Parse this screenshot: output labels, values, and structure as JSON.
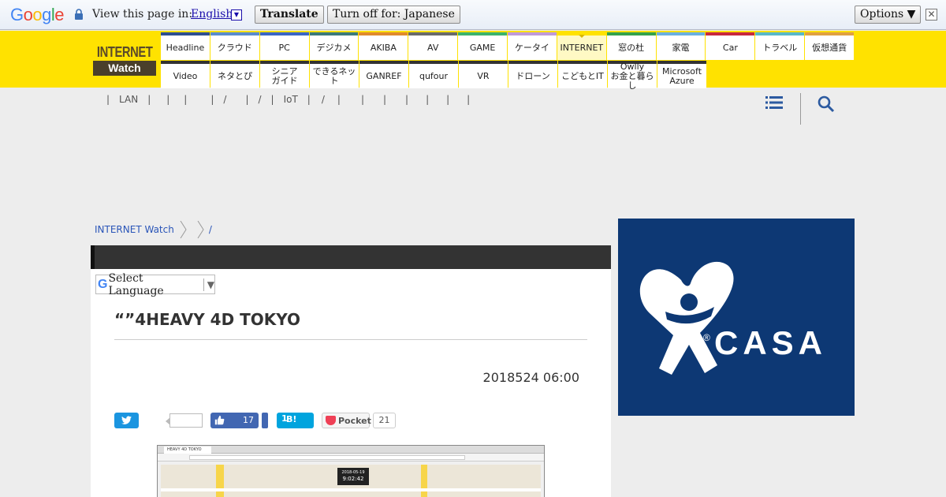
{
  "translate_bar": {
    "logo": [
      "G",
      "o",
      "o",
      "g",
      "l",
      "e"
    ],
    "logo_colors": [
      "#4285f4",
      "#ea4335",
      "#fbbc05",
      "#4285f4",
      "#34a853",
      "#ea4335"
    ],
    "view_text": "View this page in:",
    "language": "English",
    "translate_label": "Translate",
    "turn_off_label": "Turn off for: Japanese",
    "options_label": "Options ▼",
    "close_glyph": "✕"
  },
  "logo": {
    "top": "INTERNET",
    "bottom": "Watch"
  },
  "nav": {
    "row1": [
      {
        "label": "Headline",
        "color": "#2e4f8f"
      },
      {
        "label": "クラウド",
        "color": "#5a8ccc"
      },
      {
        "label": "PC",
        "color": "#3a66c4"
      },
      {
        "label": "デジカメ",
        "color": "#3c7a7a"
      },
      {
        "label": "AKIBA",
        "color": "#e08a2c"
      },
      {
        "label": "AV",
        "color": "#6a6a6a"
      },
      {
        "label": "GAME",
        "color": "#3bb36b"
      },
      {
        "label": "ケータイ",
        "color": "#c09ad8"
      },
      {
        "label": "INTERNET",
        "color": "#ffe200",
        "active": true
      },
      {
        "label": "窓の杜",
        "color": "#35a24a"
      },
      {
        "label": "家電",
        "color": "#6ab0e0"
      },
      {
        "label": "Car",
        "color": "#c8283c"
      },
      {
        "label": "トラベル",
        "color": "#58b8c8"
      },
      {
        "label": "仮想通貨",
        "color": "#e0a040"
      }
    ],
    "row2": [
      {
        "label": "Video"
      },
      {
        "label": "ネタとぴ"
      },
      {
        "label": "シニア\nガイド"
      },
      {
        "label": "できるネット"
      },
      {
        "label": "GANREF"
      },
      {
        "label": "qufour"
      },
      {
        "label": "VR"
      },
      {
        "label": "ドローン"
      },
      {
        "label": "こどもとIT"
      },
      {
        "label": "Owlly\nお金と暮らし"
      },
      {
        "label": "Microsoft\nAzure"
      }
    ]
  },
  "subnav": [
    "|",
    "LAN",
    "|",
    "|",
    "|",
    "|",
    "/",
    "|",
    "/",
    "|",
    "IoT",
    "|",
    "/",
    "|",
    "|",
    "|",
    "|",
    "|",
    "|",
    "|"
  ],
  "breadcrumb": {
    "home": "INTERNET Watch",
    "last": "/"
  },
  "select_language": "Select Language",
  "article": {
    "title": "“”4HEAVY 4D TOKYO",
    "date": "2018524 06:00"
  },
  "share": {
    "facebook_count": "17",
    "hatena_label": "B!",
    "hatena_count": "1",
    "pocket_label": "Pocket",
    "pocket_count": "21"
  },
  "screenshot": {
    "tab_title": "HEAVY 4D TOKYO",
    "clock_date": "2018-05-19",
    "clock_time": "9:02:42"
  },
  "ad": {
    "brand": "CASA",
    "registered": "®"
  }
}
